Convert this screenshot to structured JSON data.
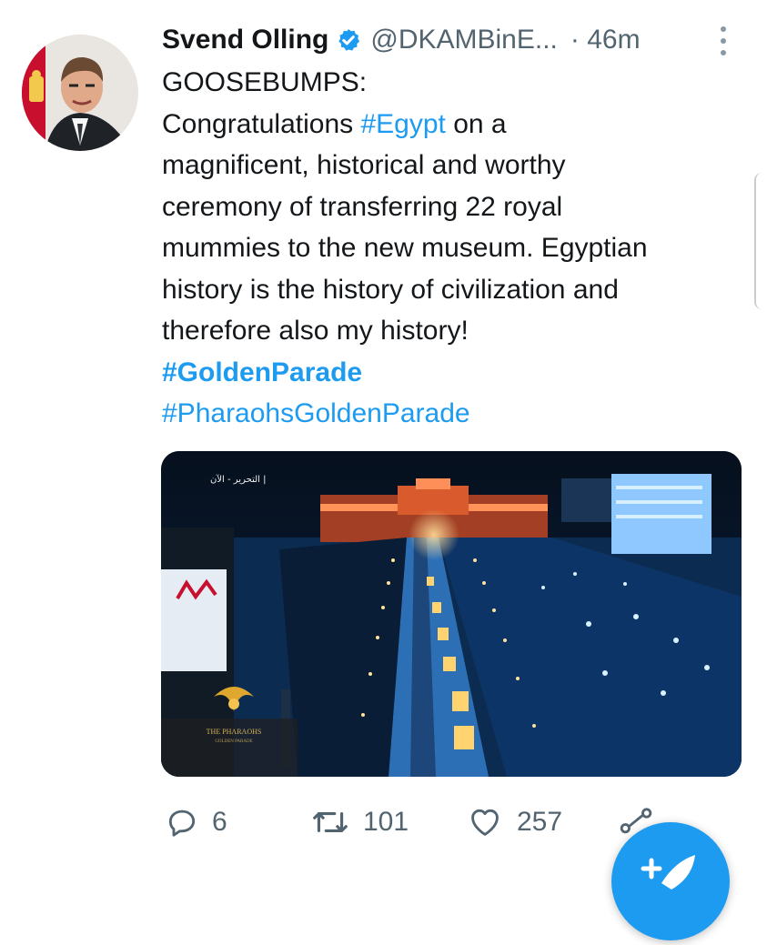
{
  "tweet": {
    "author_name": "Svend Olling",
    "handle": "@DKAMBinE...",
    "time": "· 46m",
    "lines": [
      "GOOSEBUMPS:",
      "Congratulations ",
      "magnificent, historical and worthy",
      "ceremony of transferring 22 royal",
      "mummies to the new museum. Egyptian",
      "history is the history of civilization and",
      "therefore also my history!"
    ],
    "inline_hashtag": "#Egypt",
    "line2_tail": " on a",
    "hashtags": [
      "#GoldenParade",
      "#PharaohsGoldenParade"
    ],
    "media": {
      "overlay_top_left": "التحرير - الآن |",
      "logo_text": "THE PHARAOHS",
      "logo_subtext": "GOLDEN PARADE"
    }
  },
  "actions": {
    "replies": "6",
    "retweets": "101",
    "likes": "257"
  },
  "colors": {
    "accent": "#1d9bf0",
    "text": "#14171a",
    "secondary": "#536471"
  },
  "icons": [
    "verified-badge-icon",
    "more-vertical-icon",
    "reply-icon",
    "retweet-icon",
    "like-icon",
    "share-icon",
    "compose-icon"
  ]
}
